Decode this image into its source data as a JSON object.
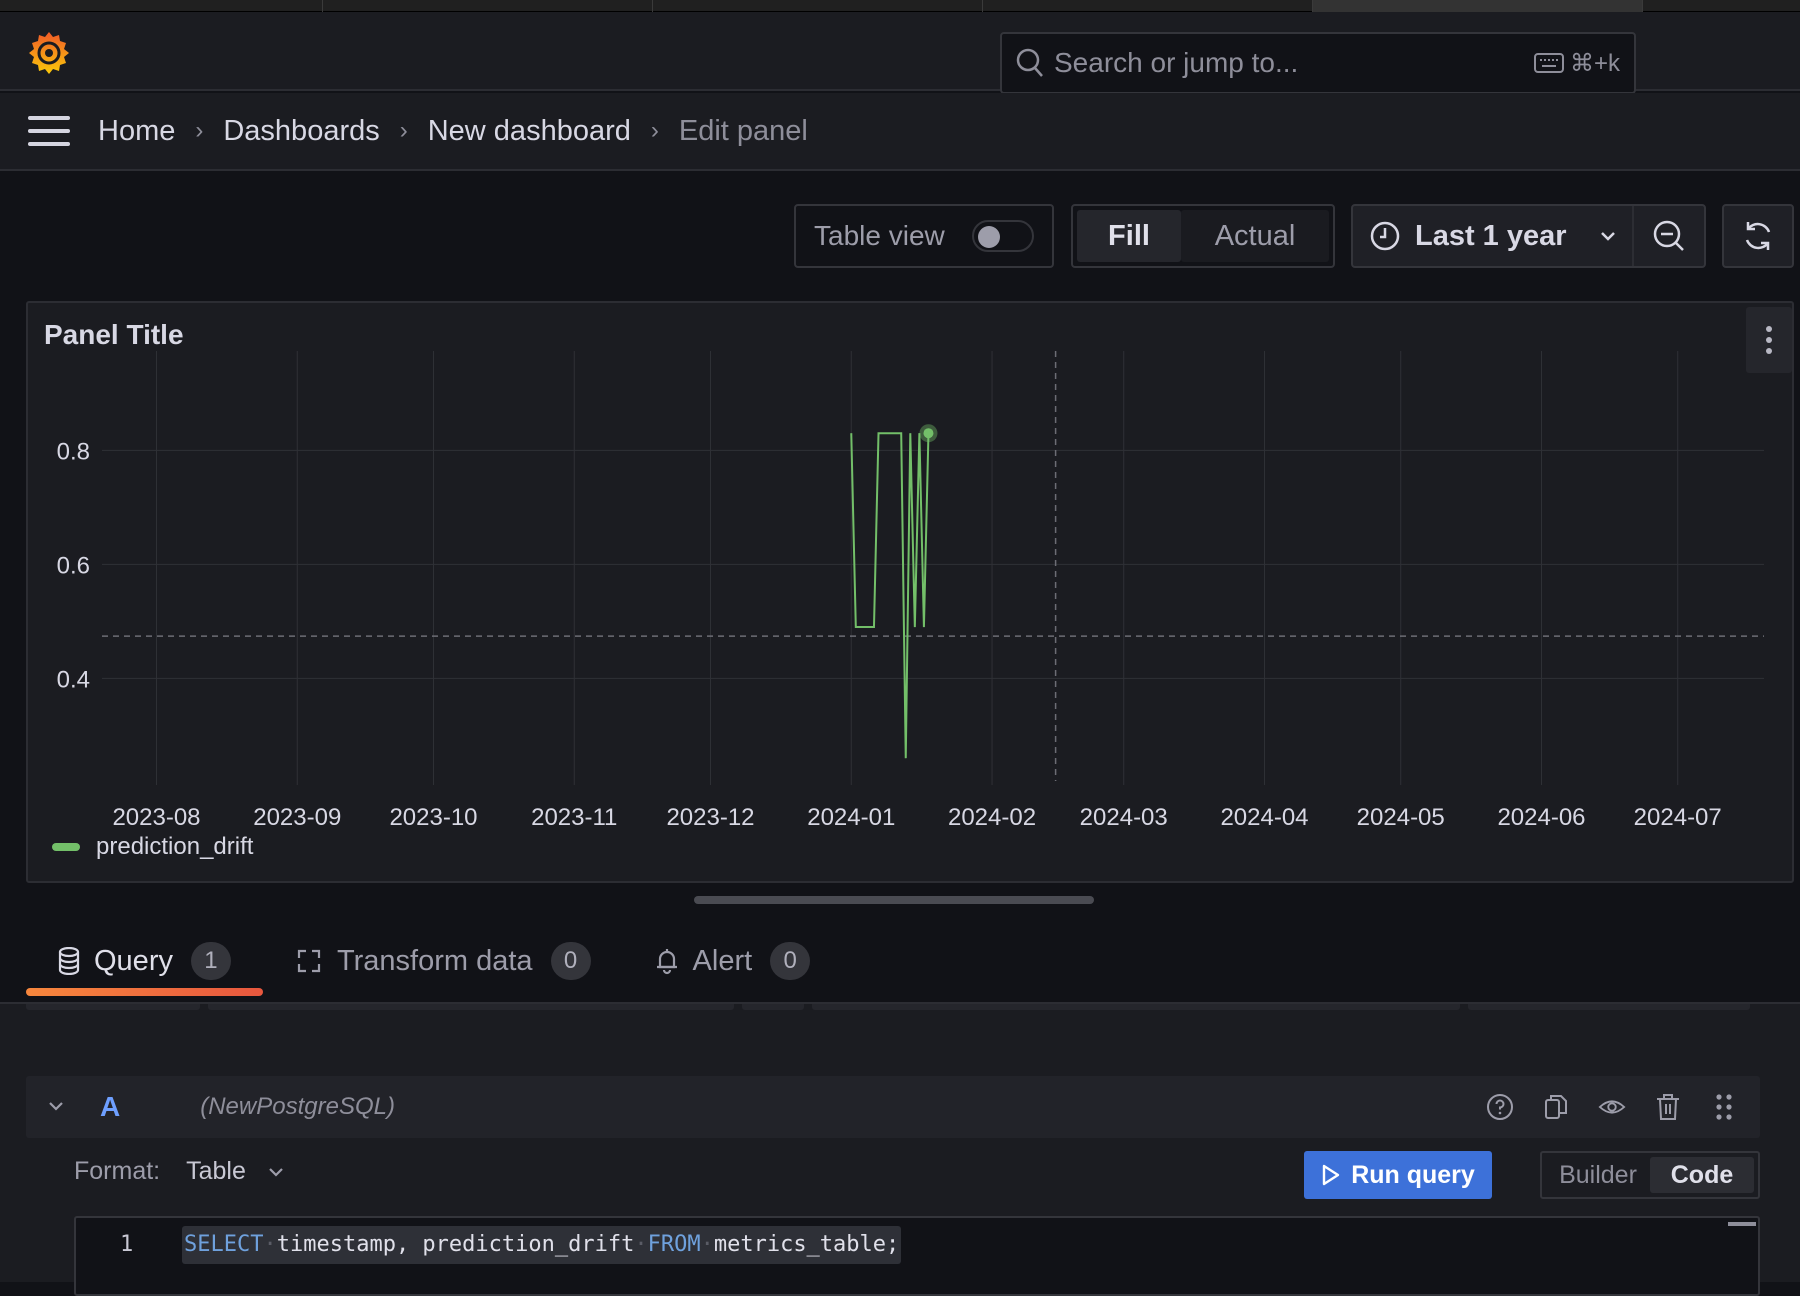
{
  "topbar": {
    "search_placeholder": "Search or jump to...",
    "search_shortcut": "⌘+k"
  },
  "breadcrumb": {
    "items": [
      "Home",
      "Dashboards",
      "New dashboard",
      "Edit panel"
    ]
  },
  "toolbar": {
    "table_view_label": "Table view",
    "table_view_on": false,
    "fill_label": "Fill",
    "actual_label": "Actual",
    "fill_selected": true,
    "time_range_label": "Last 1 year"
  },
  "panel": {
    "title": "Panel Title"
  },
  "chart_data": {
    "type": "line",
    "title": "Panel Title",
    "xlabel": "",
    "ylabel": "",
    "x_tick_labels": [
      "2023-08",
      "2023-09",
      "2023-10",
      "2023-11",
      "2023-12",
      "2024-01",
      "2024-02",
      "2024-03",
      "2024-04",
      "2024-05",
      "2024-06",
      "2024-07"
    ],
    "x_range": [
      "2023-07-20",
      "2024-07-20"
    ],
    "y_tick_labels": [
      "0.4",
      "0.6",
      "0.8"
    ],
    "y_ticks": [
      0.4,
      0.6,
      0.8
    ],
    "ylim": [
      0.22,
      0.89
    ],
    "grid": true,
    "legend_position": "bottom-left",
    "threshold_line": {
      "y": 0.474,
      "style": "dashed"
    },
    "time_marker": {
      "x": "2024-02-15",
      "style": "dashed"
    },
    "series": [
      {
        "name": "prediction_drift",
        "color": "#73bf69",
        "x": [
          "2024-01-01",
          "2024-01-02",
          "2024-01-06",
          "2024-01-07",
          "2024-01-12",
          "2024-01-13",
          "2024-01-14",
          "2024-01-15",
          "2024-01-16",
          "2024-01-17",
          "2024-01-18"
        ],
        "values": [
          0.83,
          0.49,
          0.49,
          0.83,
          0.83,
          0.26,
          0.83,
          0.49,
          0.83,
          0.49,
          0.83
        ]
      }
    ]
  },
  "query_tabs": [
    {
      "label": "Query",
      "count": "1",
      "active": true
    },
    {
      "label": "Transform data",
      "count": "0",
      "active": false
    },
    {
      "label": "Alert",
      "count": "0",
      "active": false
    }
  ],
  "query": {
    "ref_id": "A",
    "datasource": "(NewPostgreSQL)",
    "format_label": "Format:",
    "format_value": "Table",
    "run_label": "Run query",
    "mode_builder": "Builder",
    "mode_code": "Code",
    "mode_selected": "Code",
    "line_number": "1",
    "sql": {
      "kw1": "SELECT",
      "cols": "timestamp, prediction_drift",
      "kw2": "FROM",
      "table": "metrics_table;"
    }
  },
  "colors": {
    "accent_blue": "#3d71d9",
    "series_green": "#73bf69",
    "tab_underline": "#f7873d"
  }
}
